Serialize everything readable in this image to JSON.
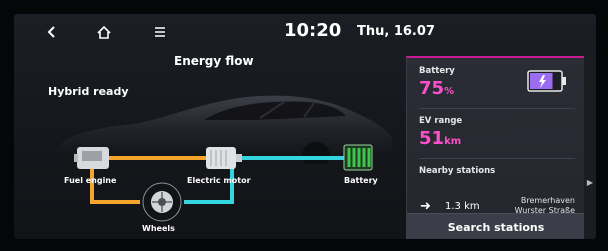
{
  "header": {
    "time": "10:20",
    "date": "Thu, 16.07",
    "icons": [
      "back-icon",
      "home-icon",
      "menu-icon"
    ]
  },
  "screen": {
    "title": "Energy flow",
    "status": "Hybrid ready"
  },
  "diagram": {
    "fuel_engine": "Fuel engine",
    "electric_motor": "Electric motor",
    "battery": "Battery",
    "wheels": "Wheels"
  },
  "panel": {
    "battery_label": "Battery",
    "battery_value": "75",
    "battery_unit": "%",
    "battery_level": 0.75,
    "ev_range_label": "EV range",
    "ev_range_value": "51",
    "ev_range_unit": "km",
    "nearby_label": "Nearby stations",
    "station_distance": "1.3 km",
    "station_city": "Bremerhaven",
    "station_street": "Wurster Straße",
    "search_label": "Search stations"
  },
  "colors": {
    "accent": "#ff4fcb",
    "fuel_flow": "#f4a52a",
    "electric_flow": "#33d6de",
    "battery_charge": "#39b54a"
  }
}
